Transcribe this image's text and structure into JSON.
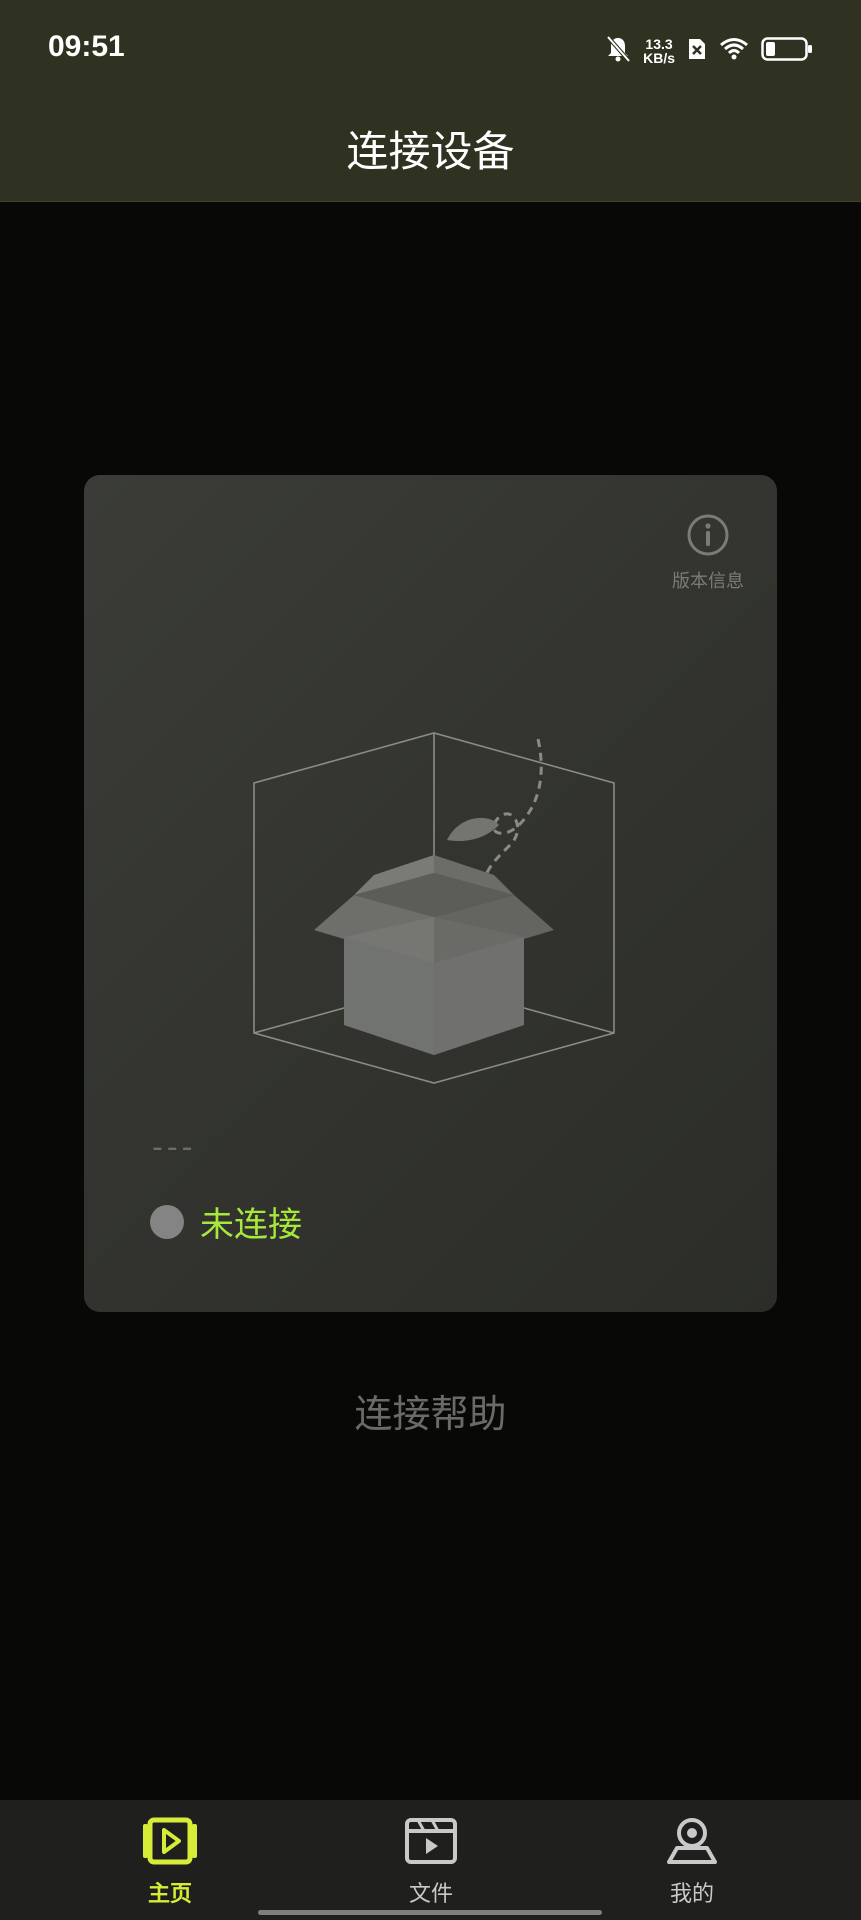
{
  "status_bar": {
    "time": "09:51",
    "net_speed_value": "13.3",
    "net_speed_unit": "KB/s",
    "battery_level": 0.25,
    "icons": [
      "bell-muted-icon",
      "sim-x-icon",
      "wifi-icon",
      "battery-icon"
    ]
  },
  "header": {
    "title": "连接设备"
  },
  "card": {
    "version_label": "版本信息",
    "device_name": "---",
    "connection_status": "未连接"
  },
  "help_link": "连接帮助",
  "tabs": [
    {
      "label": "主页",
      "icon": "home-video-icon",
      "active": true
    },
    {
      "label": "文件",
      "icon": "film-file-icon",
      "active": false
    },
    {
      "label": "我的",
      "icon": "profile-icon",
      "active": false
    }
  ],
  "colors": {
    "accent": "#d6ec37",
    "status_green": "#a6e93c",
    "header_bg": "#2f3121",
    "page_bg": "#080906",
    "card_bg": "#363733"
  }
}
